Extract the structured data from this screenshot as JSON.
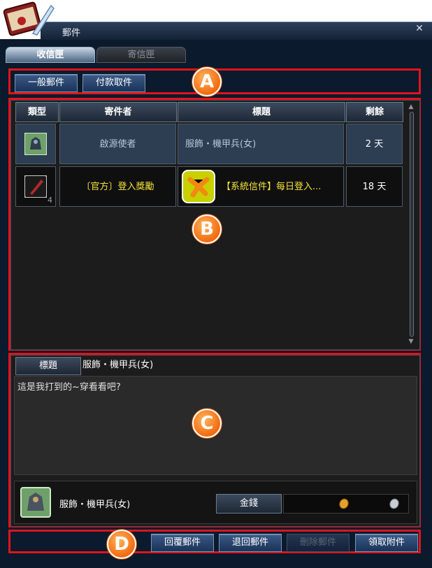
{
  "window": {
    "title": "郵件"
  },
  "tabs": {
    "inbox": "收信匣",
    "outbox": "寄信匣"
  },
  "filters": {
    "normal": "一般郵件",
    "cod": "付款取件"
  },
  "table": {
    "headers": {
      "type": "類型",
      "sender": "寄件者",
      "subject": "標題",
      "remaining": "剩餘"
    },
    "rows": [
      {
        "sender": "啟源使者",
        "subject": "服飾・機甲兵(女)",
        "remaining": "2 天",
        "item_count": ""
      },
      {
        "sender": "〔官方〕登入獎勵",
        "subject": "【系統信件】每日登入...",
        "remaining": "18 天",
        "item_count": "4"
      }
    ]
  },
  "detail": {
    "subject_label": "標題",
    "subject_value": "服飾・機甲兵(女)",
    "body": "這是我打到的~穿看看吧?",
    "attachment_name": "服飾・機甲兵(女)",
    "money_label": "金錢"
  },
  "actions": {
    "reply": "回覆郵件",
    "return": "退回郵件",
    "delete": "刪除郵件",
    "claim": "領取附件"
  },
  "callouts": {
    "a": "A",
    "b": "B",
    "c": "C",
    "d": "D"
  },
  "colors": {
    "highlight_red": "#e0141a",
    "callout_orange": "#f26b10",
    "sender_gold": "#f2e33a"
  },
  "icons": {
    "logo": "mail-quill-icon",
    "close": "close-icon",
    "type1": "armor-item-icon",
    "type2": "weapon-item-icon",
    "system": "system-mail-icon",
    "gold_coin": "gold-coin-icon",
    "silver_coin": "silver-coin-icon"
  }
}
